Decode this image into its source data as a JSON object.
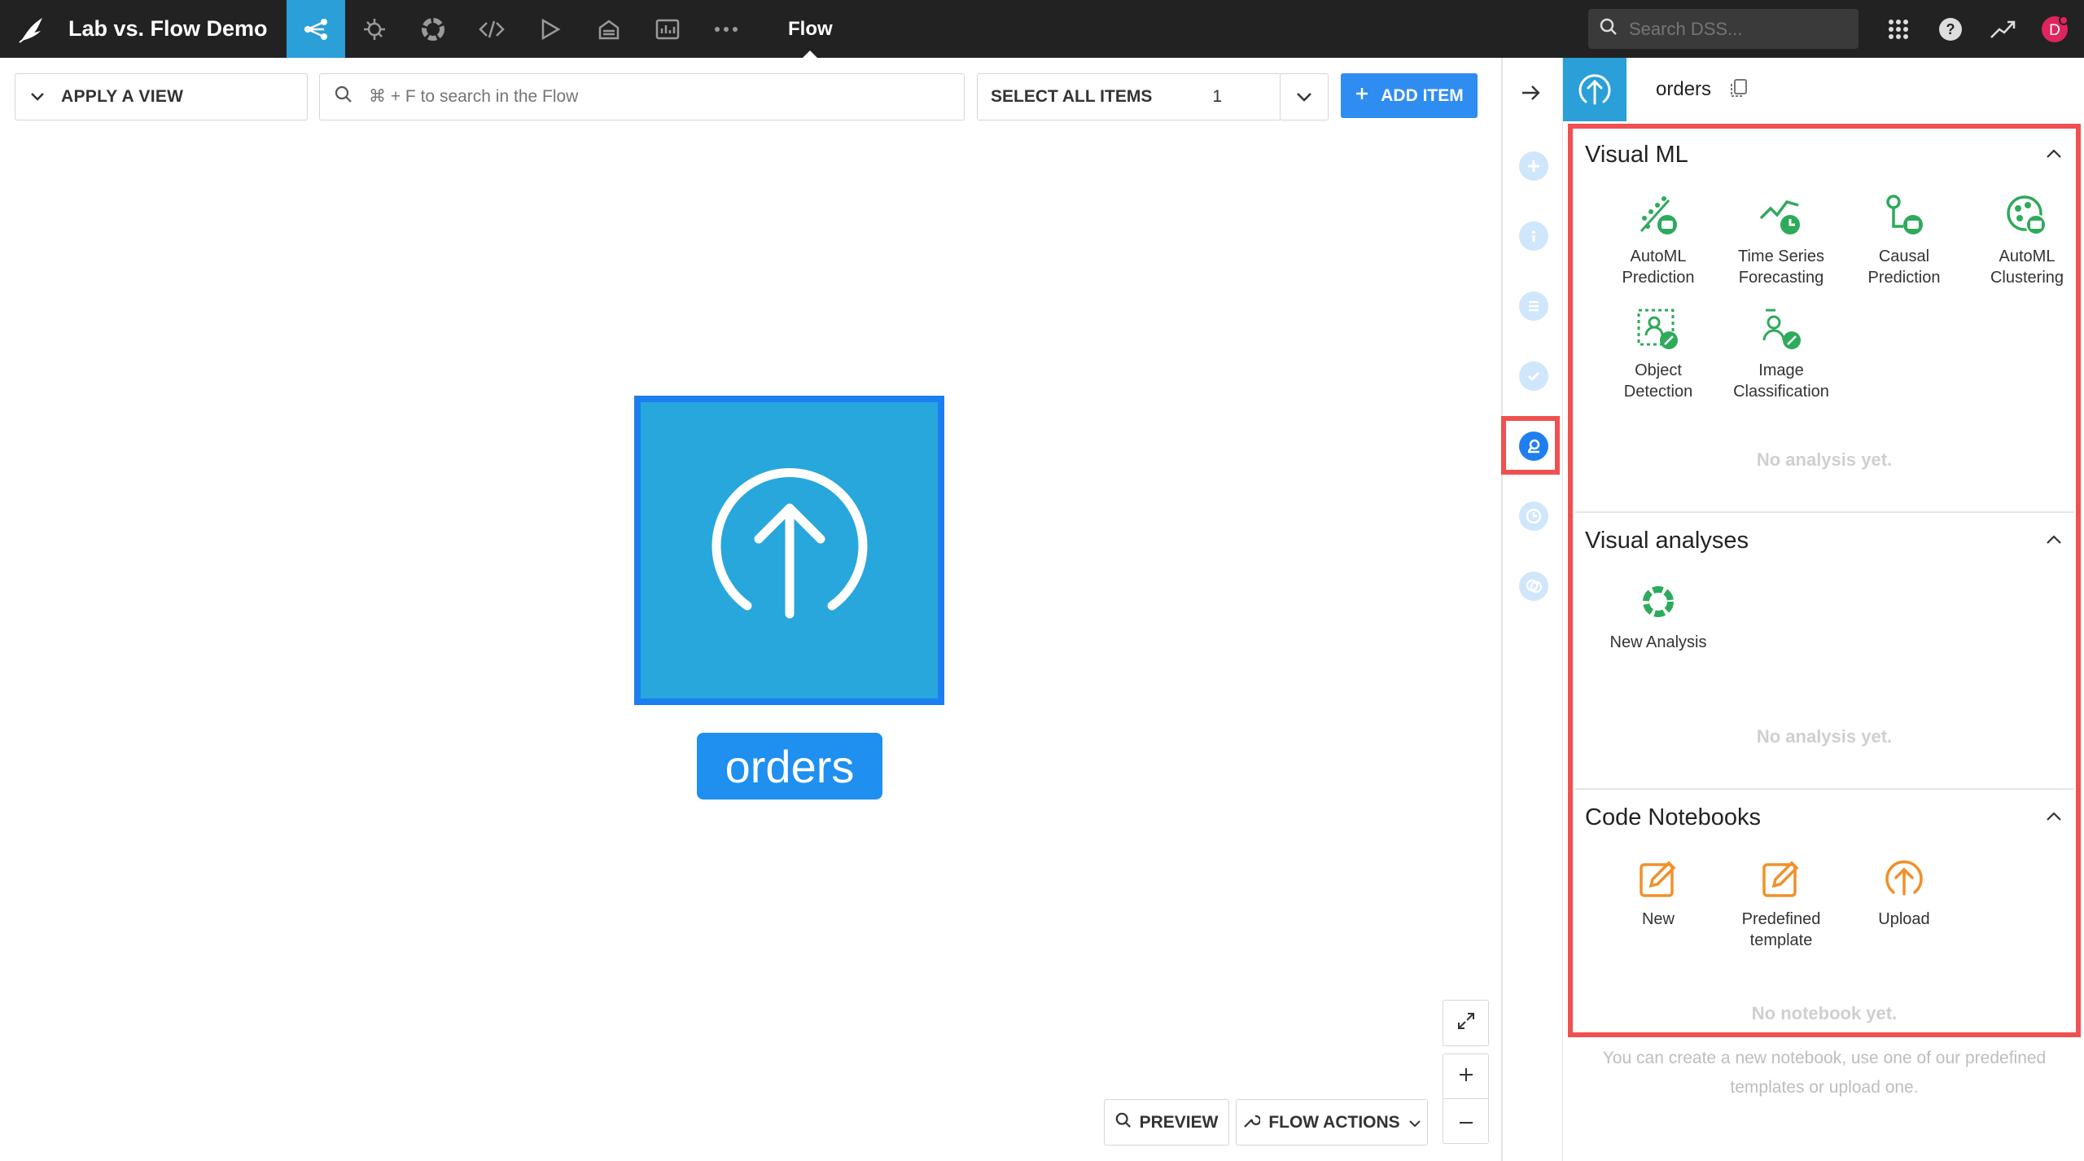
{
  "topbar": {
    "project_title": "Lab vs. Flow Demo",
    "flow_label": "Flow",
    "search_placeholder": "Search DSS...",
    "avatar_letter": "D",
    "nav_icons": [
      "flow-icon",
      "lab-icon",
      "recipes-icon",
      "code-icon",
      "run-icon",
      "dashboards-icon",
      "reports-icon",
      "more-icon"
    ]
  },
  "toolbar": {
    "apply_view": "APPLY A VIEW",
    "search_placeholder": "⌘ + F to search in the Flow",
    "select_all": "SELECT ALL ITEMS",
    "select_count": "1",
    "add_item": "ADD ITEM"
  },
  "canvas": {
    "node_label": "orders",
    "preview": "PREVIEW",
    "flow_actions": "FLOW ACTIONS"
  },
  "panel": {
    "title": "orders",
    "sections": [
      {
        "title": "Visual ML",
        "items": [
          {
            "line1": "AutoML",
            "line2": "Prediction"
          },
          {
            "line1": "Time Series",
            "line2": "Forecasting"
          },
          {
            "line1": "Causal",
            "line2": "Prediction"
          },
          {
            "line1": "AutoML",
            "line2": "Clustering"
          },
          {
            "line1": "Object",
            "line2": "Detection"
          },
          {
            "line1": "Image",
            "line2": "Classification"
          }
        ],
        "empty": "No analysis yet."
      },
      {
        "title": "Visual analyses",
        "items": [
          {
            "line1": "New Analysis",
            "line2": ""
          }
        ],
        "empty": "No analysis yet."
      },
      {
        "title": "Code Notebooks",
        "items": [
          {
            "line1": "New",
            "line2": ""
          },
          {
            "line1": "Predefined",
            "line2": "template"
          },
          {
            "line1": "Upload",
            "line2": ""
          }
        ],
        "empty": "No notebook yet."
      }
    ],
    "help_line1": "You can create a new notebook, use one of our predefined",
    "help_line2": "templates or upload one."
  },
  "colors": {
    "accent_blue": "#2a9fd8",
    "button_blue": "#2f8cf0",
    "highlight_red": "#f05050",
    "ml_green": "#2eaa5c",
    "notebook_orange": "#f0902a"
  }
}
